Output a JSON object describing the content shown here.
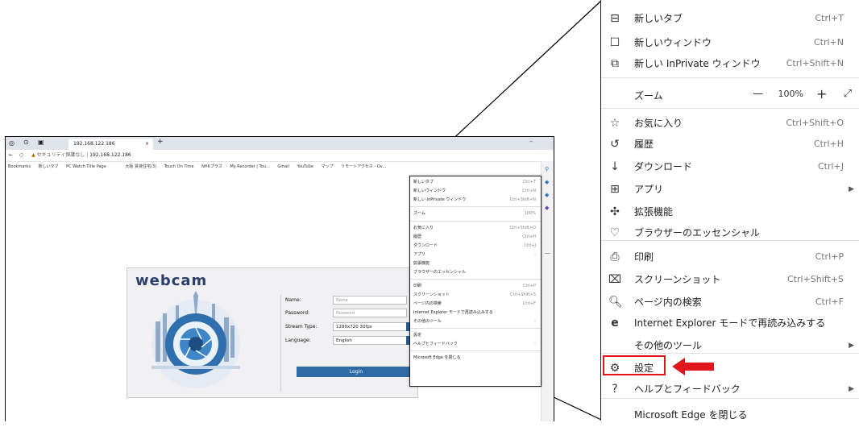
{
  "small_browser": {
    "tab_title": "192.168.122.186",
    "tab_close": "×",
    "tab_add": "+",
    "address_warning": "セキュリティ保護なし",
    "address_url": "192.168.122.186",
    "bookmarks": [
      "Bookmarks",
      "新しいタブ",
      "PC Watch Title Page",
      "大阪 賃貸住宅(3)",
      "Touch On Time",
      "NHKプラス",
      "My Recorder | Tou...",
      "Gmail",
      "YouTube",
      "マップ",
      "リモートアクセス - Ov..."
    ],
    "logo": "webcam",
    "form": {
      "name_label": "Name:",
      "name_placeholder": "Name",
      "password_label": "Password:",
      "password_placeholder": "Password",
      "stream_label": "Stream Type:",
      "stream_value": "1280x720 30fps",
      "language_label": "Language:",
      "language_value": "English",
      "login_button": "Login"
    },
    "menu_items": [
      {
        "label": "新しいタブ",
        "shortcut": "Ctrl+T"
      },
      {
        "label": "新しいウィンドウ",
        "shortcut": "Ctrl+N"
      },
      {
        "label": "新しい InPrivate ウィンドウ",
        "shortcut": "Ctrl+Shift+N"
      },
      {
        "label": "ズーム",
        "shortcut": "100%"
      },
      {
        "label": "お気に入り",
        "shortcut": "Ctrl+Shift+O"
      },
      {
        "label": "履歴",
        "shortcut": "Ctrl+H"
      },
      {
        "label": "ダウンロード",
        "shortcut": "Ctrl+J"
      },
      {
        "label": "アプリ",
        "shortcut": ""
      },
      {
        "label": "拡張機能",
        "shortcut": ""
      },
      {
        "label": "ブラウザーのエッセンシャル",
        "shortcut": ""
      },
      {
        "label": "印刷",
        "shortcut": "Ctrl+P"
      },
      {
        "label": "スクリーンショット",
        "shortcut": "Ctrl+Shift+S"
      },
      {
        "label": "ページ内の検索",
        "shortcut": "Ctrl+F"
      },
      {
        "label": "Internet Explorer モードで再読み込みする",
        "shortcut": ""
      },
      {
        "label": "その他のツール",
        "shortcut": ""
      },
      {
        "label": "設定",
        "shortcut": ""
      },
      {
        "label": "ヘルプとフィードバック",
        "shortcut": ""
      },
      {
        "label": "Microsoft Edge を閉じる",
        "shortcut": ""
      }
    ]
  },
  "menu": {
    "new_tab": {
      "label": "新しいタブ",
      "shortcut": "Ctrl+T"
    },
    "new_window": {
      "label": "新しいウィンドウ",
      "shortcut": "Ctrl+N"
    },
    "new_inprivate": {
      "label": "新しい InPrivate ウィンドウ",
      "shortcut": "Ctrl+Shift+N"
    },
    "zoom": {
      "label": "ズーム",
      "minus": "—",
      "value": "100%",
      "plus": "+",
      "expand": "⤢"
    },
    "favorites": {
      "label": "お気に入り",
      "shortcut": "Ctrl+Shift+O"
    },
    "history": {
      "label": "履歴",
      "shortcut": "Ctrl+H"
    },
    "downloads": {
      "label": "ダウンロード",
      "shortcut": "Ctrl+J"
    },
    "apps": {
      "label": "アプリ"
    },
    "extensions": {
      "label": "拡張機能"
    },
    "essentials": {
      "label": "ブラウザーのエッセンシャル"
    },
    "print": {
      "label": "印刷",
      "shortcut": "Ctrl+P"
    },
    "screenshot": {
      "label": "スクリーンショット",
      "shortcut": "Ctrl+Shift+S"
    },
    "find": {
      "label": "ページ内の検索",
      "shortcut": "Ctrl+F"
    },
    "ie_mode": {
      "label": "Internet Explorer モードで再読み込みする"
    },
    "more_tools": {
      "label": "その他のツール"
    },
    "settings": {
      "label": "設定"
    },
    "help": {
      "label": "ヘルプとフィードバック"
    },
    "close_edge": {
      "label": "Microsoft Edge を閉じる"
    }
  },
  "colors": {
    "highlight": "#e0161b",
    "arrow": "#e0161b",
    "login_button": "#2d6aa6"
  }
}
